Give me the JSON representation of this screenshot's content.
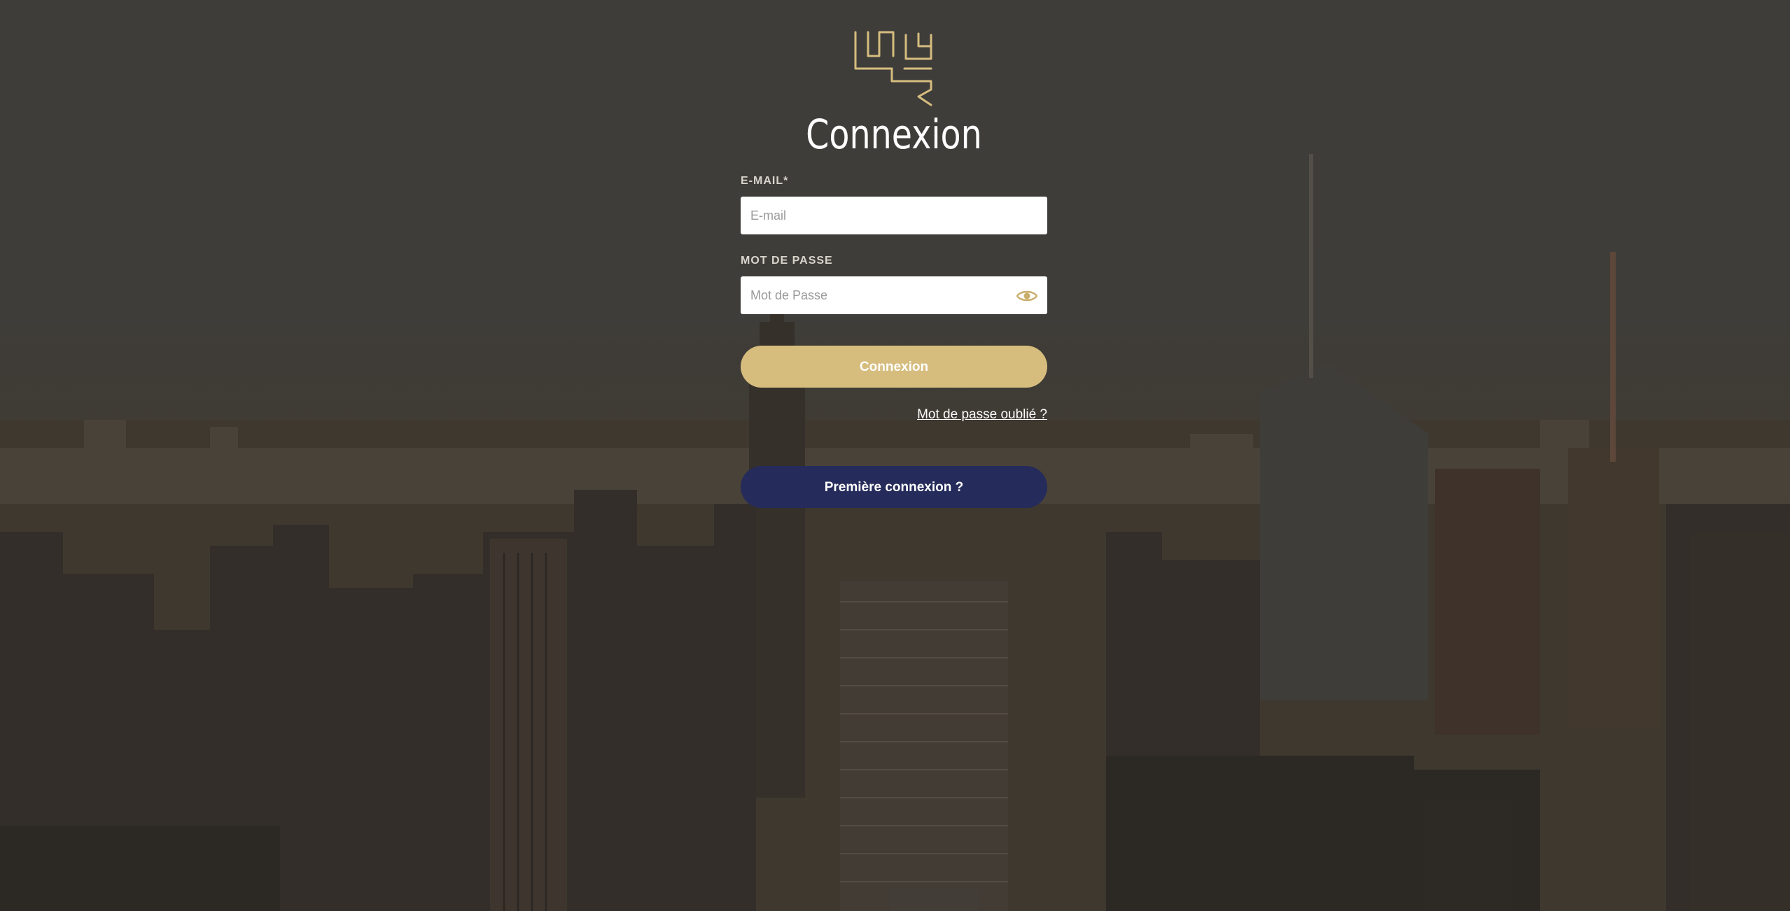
{
  "login": {
    "title": "Connexion",
    "email": {
      "label": "E-MAIL*",
      "placeholder": "E-mail",
      "value": ""
    },
    "password": {
      "label": "MOT DE PASSE",
      "placeholder": "Mot de Passe",
      "value": ""
    },
    "submit_label": "Connexion",
    "forgot_label": "Mot de passe oublié ?",
    "first_login_label": "Première connexion ?"
  },
  "icons": {
    "logo": "brand-logo-icon",
    "password_toggle": "eye-icon"
  },
  "colors": {
    "accent_gold": "#d6bd7e",
    "navy": "#252b5a",
    "text_white": "#ffffff"
  }
}
